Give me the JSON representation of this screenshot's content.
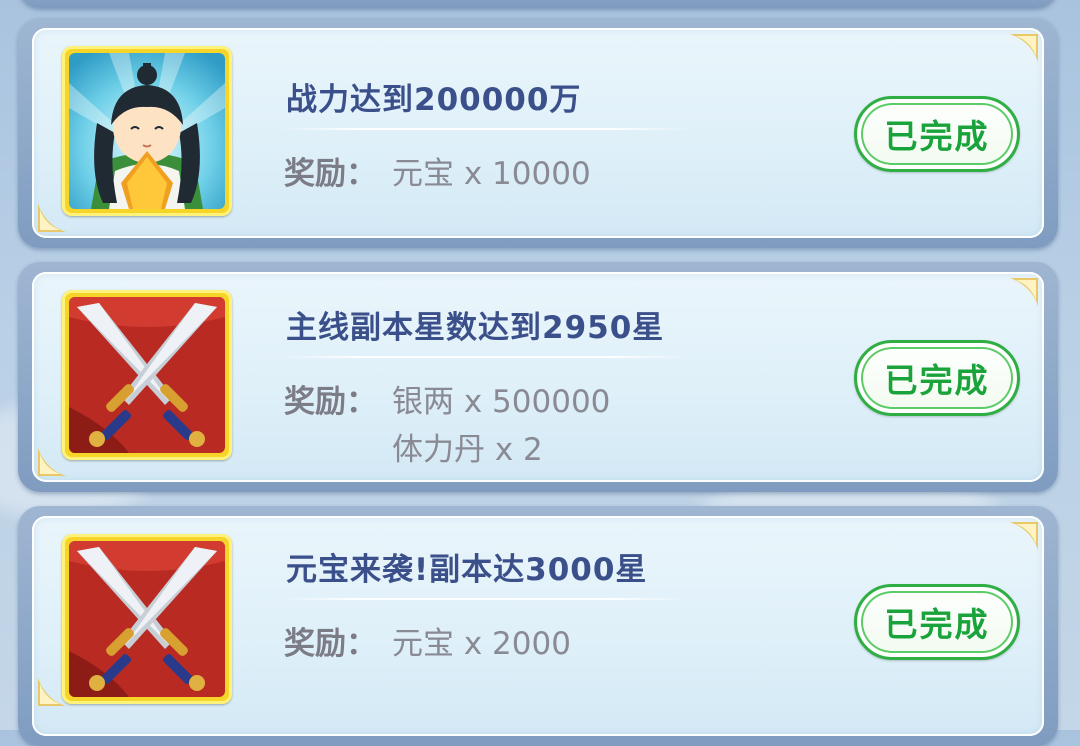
{
  "tasks": [
    {
      "title": "战力达到200000万",
      "reward_label": "奖励：",
      "rewards": [
        "元宝 x 10000"
      ],
      "status": "已完成",
      "icon": "hero-character-icon"
    },
    {
      "title": "主线副本星数达到2950星",
      "reward_label": "奖励：",
      "rewards": [
        "银两 x 500000",
        "体力丹 x 2"
      ],
      "status": "已完成",
      "icon": "crossed-swords-icon"
    },
    {
      "title": "元宝来袭!副本达3000星",
      "reward_label": "奖励：",
      "rewards": [
        "元宝 x 2000"
      ],
      "status": "已完成",
      "icon": "crossed-swords-icon"
    }
  ],
  "colors": {
    "title": "#3b4f8a",
    "done_green": "#1aa33a",
    "icon_frame": "#f6d428"
  }
}
